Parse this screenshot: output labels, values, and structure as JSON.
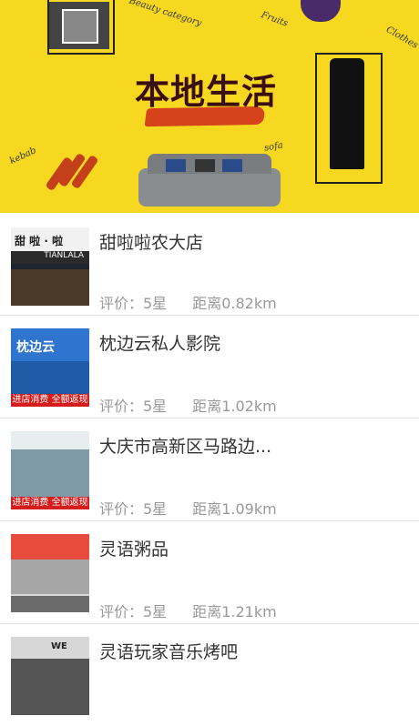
{
  "banner": {
    "title": "本地生活",
    "labels": {
      "beauty": "Beauty category",
      "fruits": "Fruits",
      "clothes": "Clothes",
      "sofa": "sofa",
      "kebab": "kebab"
    }
  },
  "stores": [
    {
      "name": "甜啦啦农大店",
      "rating": "评价：5星",
      "distance": "距离0.82km",
      "sign_top": "甜 啦 · 啦",
      "sign_brand": "TIANLALA"
    },
    {
      "name": "枕边云私人影院",
      "rating": "评价：5星",
      "distance": "距离1.02km",
      "sign_top": "枕边云",
      "promo": "进店消费 全额返现"
    },
    {
      "name": "大庆市高新区马路边...",
      "rating": "评价：5星",
      "distance": "距离1.09km",
      "promo": "进店消费 全额返现"
    },
    {
      "name": "灵语粥品",
      "rating": "评价：5星",
      "distance": "距离1.21km"
    },
    {
      "name": "灵语玩家音乐烤吧",
      "sign_brand": "WE"
    }
  ]
}
